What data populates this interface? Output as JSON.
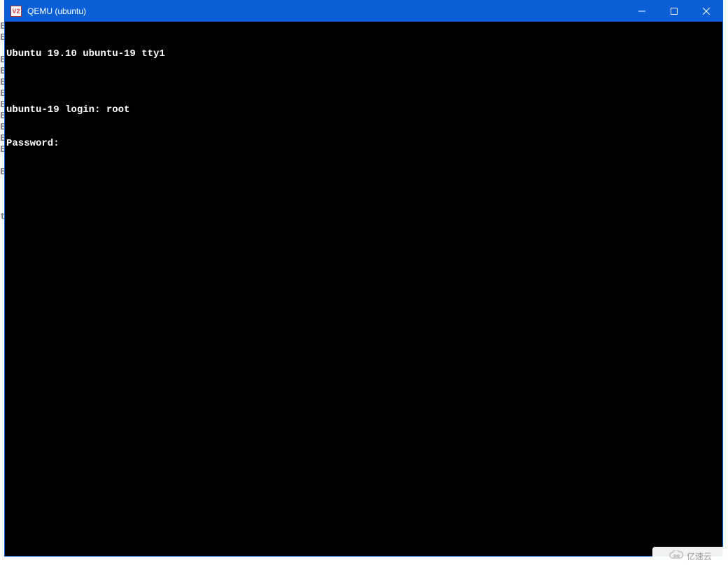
{
  "window": {
    "icon_label": "V2",
    "title": "QEMU (ubuntu)"
  },
  "left_artifact": "E\nE\n\nE\nE\nE\nE\nE\nE\nE\nE\nE\n\nE\n\n\n\nt",
  "terminal": {
    "line1": "Ubuntu 19.10 ubuntu-19 tty1",
    "blank": "",
    "login_prompt": "ubuntu-19 login: ",
    "login_value": "root",
    "password_prompt": "Password:"
  },
  "watermark": {
    "text": "亿速云"
  }
}
